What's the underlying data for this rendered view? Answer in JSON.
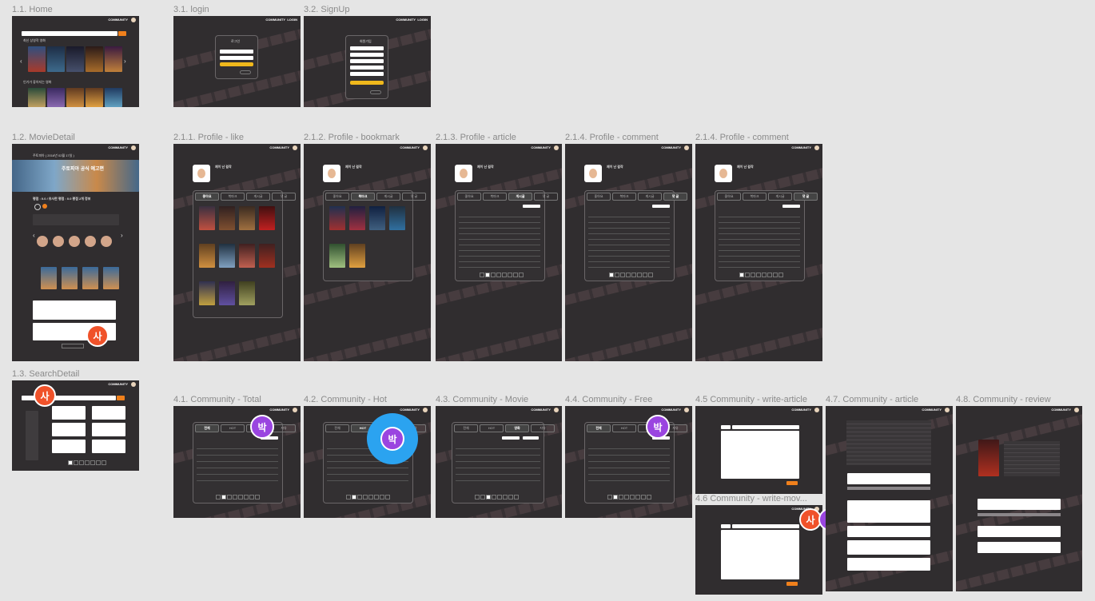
{
  "frames": [
    {
      "id": "home",
      "label": "1.1. Home"
    },
    {
      "id": "login",
      "label": "3.1. login"
    },
    {
      "id": "signup",
      "label": "3.2. SignUp"
    },
    {
      "id": "movie_detail",
      "label": "1.2. MovieDetail"
    },
    {
      "id": "profile_like",
      "label": "2.1.1. Profile - like"
    },
    {
      "id": "profile_bookmark",
      "label": "2.1.2. Profile - bookmark"
    },
    {
      "id": "profile_article",
      "label": "2.1.3. Profile - article"
    },
    {
      "id": "profile_comment_1",
      "label": "2.1.4. Profile - comment"
    },
    {
      "id": "profile_comment_2",
      "label": "2.1.4. Profile - comment"
    },
    {
      "id": "search_detail",
      "label": "1.3. SearchDetail"
    },
    {
      "id": "community_total",
      "label": "4.1. Community - Total"
    },
    {
      "id": "community_hot",
      "label": "4.2. Community - Hot"
    },
    {
      "id": "community_movie",
      "label": "4.3. Community - Movie"
    },
    {
      "id": "community_free",
      "label": "4.4. Community - Free"
    },
    {
      "id": "write_article",
      "label": "4.5 Community - write-article"
    },
    {
      "id": "write_movie",
      "label": "4.6 Community - write-mov..."
    },
    {
      "id": "community_article",
      "label": "4.7. Community - article"
    },
    {
      "id": "community_review",
      "label": "4.8. Community - review"
    }
  ],
  "topbar": {
    "community": "COMMUNITY",
    "login": "LOGIN"
  },
  "login": {
    "title": "로그인"
  },
  "signup": {
    "title": "회원가입"
  },
  "profile": {
    "name": "제이 난 걸작"
  },
  "profile_tabs": [
    "좋아요",
    "북마크",
    "게시글",
    "댓 글"
  ],
  "community_tabs": [
    "전체",
    "HOT",
    "영화",
    "자유"
  ],
  "movie_detail": {
    "title": "주토피아 ( 2016년 02월 17일 )",
    "trailer": "주토피아 공식 예고편",
    "rating": "평점 : 0.0 / 유사한 평점 : 0.0 평점 2개 정보"
  },
  "home": {
    "section1": "최신 상영작 영화",
    "section2": "인기가 좋아지는 영화"
  },
  "cursors": {
    "sa": "사",
    "bak": "박"
  }
}
